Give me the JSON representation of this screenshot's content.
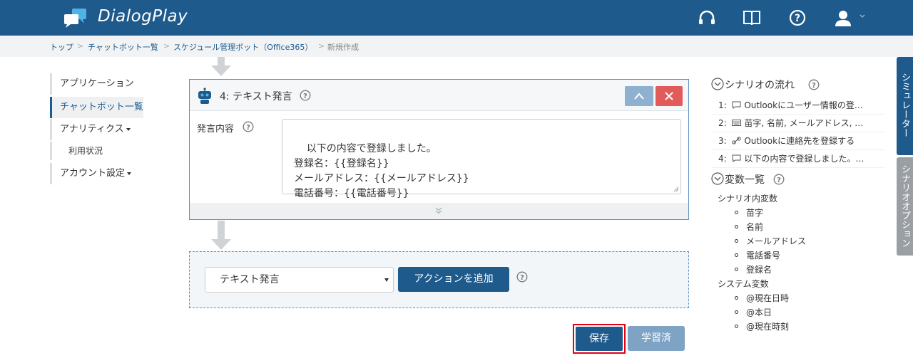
{
  "header": {
    "brand": "DialogPlay",
    "icons": [
      "headset-icon",
      "book-icon",
      "help-icon",
      "user-icon"
    ]
  },
  "breadcrumb": {
    "items": [
      "トップ",
      "チャットボット一覧",
      "スケジュール管理ボット（Office365）"
    ],
    "current": "新規作成",
    "separator": ">"
  },
  "nav": {
    "items": [
      "アプリケーション",
      "チャットボット一覧",
      "アナリティクス",
      "利用状況",
      "アカウント設定"
    ]
  },
  "card": {
    "title": "4: テキスト発言",
    "field_label": "発言内容",
    "speech_text": "以下の内容で登録しました。\n登録名：{{登録名}}\nメールアドレス：{{メールアドレス}}\n電話番号：{{電話番号}}"
  },
  "action": {
    "selected": "テキスト発言",
    "add_label": "アクションを追加"
  },
  "buttons": {
    "save": "保存",
    "learned": "学習済"
  },
  "scenario": {
    "title": "シナリオの流れ",
    "steps": [
      {
        "num": "1:",
        "text": "Outlookにユーザー情報の登…"
      },
      {
        "num": "2:",
        "text": "苗字, 名前, メールアドレス, …"
      },
      {
        "num": "3:",
        "text": "Outlookに連絡先を登録する"
      },
      {
        "num": "4:",
        "text": "以下の内容で登録しました。…"
      }
    ]
  },
  "variables": {
    "title": "変数一覧",
    "scenario_group": "シナリオ内変数",
    "scenario_vars": [
      "苗字",
      "名前",
      "メールアドレス",
      "電話番号",
      "登録名"
    ],
    "system_group": "システム変数",
    "system_vars": [
      "@現在日時",
      "@本日",
      "@現在時刻"
    ]
  },
  "side_tabs": {
    "simulator": "シミュレーター",
    "options": "シナリオオプション"
  },
  "colors": {
    "primary": "#1e5a8c",
    "danger": "#e25b5b",
    "highlight": "#e60012"
  }
}
